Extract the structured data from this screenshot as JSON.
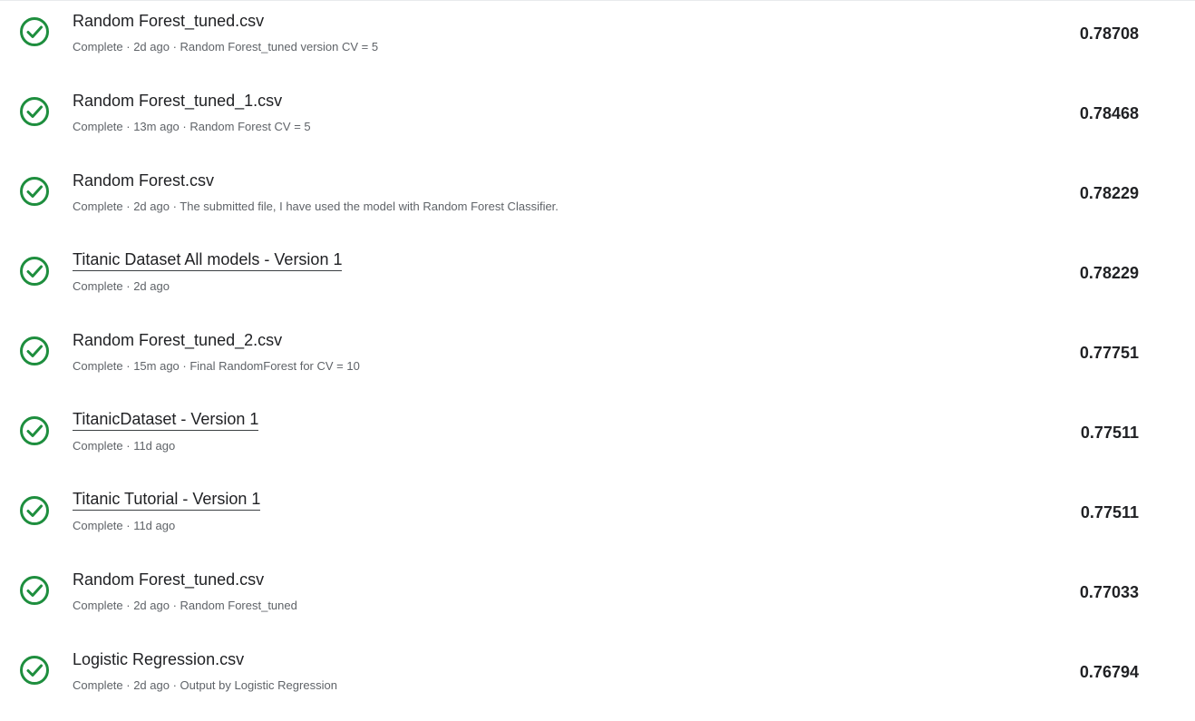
{
  "colors": {
    "success_green": "#1e8e3e",
    "text_primary": "#202124",
    "text_secondary": "#5f6368"
  },
  "submissions": [
    {
      "title": "Random Forest_tuned.csv",
      "is_link": false,
      "status_icon": "check-circle-icon",
      "meta": "Complete · 2d ago · Random Forest_tuned version CV = 5",
      "score": "0.78708"
    },
    {
      "title": "Random Forest_tuned_1.csv",
      "is_link": false,
      "status_icon": "check-circle-icon",
      "meta": "Complete · 13m ago · Random Forest CV = 5",
      "score": "0.78468"
    },
    {
      "title": "Random Forest.csv",
      "is_link": false,
      "status_icon": "check-circle-icon",
      "meta": "Complete · 2d ago · The submitted file, I have used the model with Random Forest Classifier.",
      "score": "0.78229"
    },
    {
      "title": "Titanic Dataset All models - Version 1",
      "is_link": true,
      "status_icon": "check-circle-icon",
      "meta": "Complete · 2d ago",
      "score": "0.78229"
    },
    {
      "title": "Random Forest_tuned_2.csv",
      "is_link": false,
      "status_icon": "check-circle-icon",
      "meta": "Complete · 15m ago · Final RandomForest for CV = 10",
      "score": "0.77751"
    },
    {
      "title": "TitanicDataset - Version 1",
      "is_link": true,
      "status_icon": "check-circle-icon",
      "meta": "Complete · 11d ago",
      "score": "0.77511"
    },
    {
      "title": "Titanic Tutorial - Version 1",
      "is_link": true,
      "status_icon": "check-circle-icon",
      "meta": "Complete · 11d ago",
      "score": "0.77511"
    },
    {
      "title": "Random Forest_tuned.csv",
      "is_link": false,
      "status_icon": "check-circle-icon",
      "meta": "Complete · 2d ago · Random Forest_tuned",
      "score": "0.77033"
    },
    {
      "title": "Logistic Regression.csv",
      "is_link": false,
      "status_icon": "check-circle-icon",
      "meta": "Complete · 2d ago · Output by Logistic Regression",
      "score": "0.76794"
    }
  ]
}
